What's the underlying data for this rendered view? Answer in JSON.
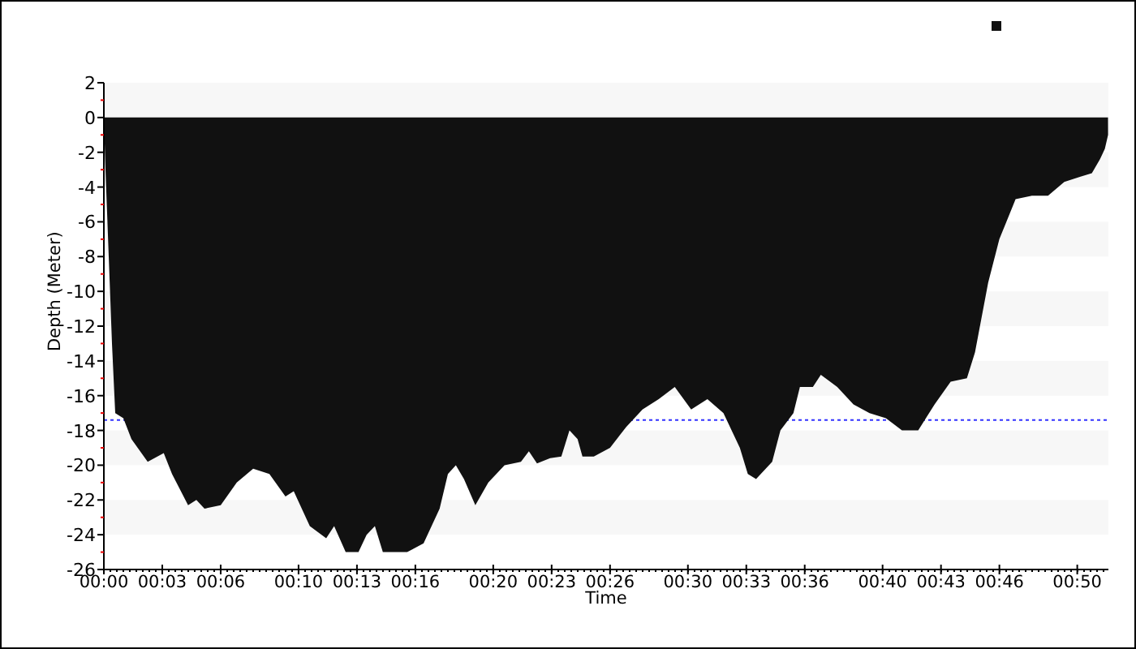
{
  "chart_data": {
    "type": "area",
    "xlabel": "Time",
    "ylabel": "Depth (Meter)",
    "xlim": [
      0,
      51.6
    ],
    "ylim": [
      -26,
      2
    ],
    "xticks": [
      {
        "value": 0,
        "label": "00:00"
      },
      {
        "value": 3,
        "label": "00:03"
      },
      {
        "value": 6,
        "label": "00:06"
      },
      {
        "value": 10,
        "label": "00:10"
      },
      {
        "value": 13,
        "label": "00:13"
      },
      {
        "value": 16,
        "label": "00:16"
      },
      {
        "value": 20,
        "label": "00:20"
      },
      {
        "value": 23,
        "label": "00:23"
      },
      {
        "value": 26,
        "label": "00:26"
      },
      {
        "value": 30,
        "label": "00:30"
      },
      {
        "value": 33,
        "label": "00:33"
      },
      {
        "value": 36,
        "label": "00:36"
      },
      {
        "value": 40,
        "label": "00:40"
      },
      {
        "value": 43,
        "label": "00:43"
      },
      {
        "value": 46,
        "label": "00:46"
      },
      {
        "value": 50,
        "label": "00:50"
      }
    ],
    "yticks": [
      2,
      0,
      -2,
      -4,
      -6,
      -8,
      -10,
      -12,
      -14,
      -16,
      -18,
      -20,
      -22,
      -24,
      -26
    ],
    "x": [
      0,
      0.08,
      0.25,
      0.42,
      0.58,
      1,
      1.42,
      2.25,
      3.08,
      3.5,
      4.33,
      4.75,
      5.17,
      6,
      6.83,
      7.67,
      8.5,
      9.33,
      9.75,
      10.58,
      11.42,
      11.83,
      12.42,
      13.08,
      13.5,
      13.92,
      14.33,
      15.58,
      16.42,
      17.25,
      17.67,
      18.08,
      18.5,
      19.08,
      19.75,
      20.58,
      21.42,
      21.83,
      22.25,
      22.92,
      23.5,
      23.92,
      24.33,
      24.58,
      25.17,
      26,
      26.83,
      27.67,
      28.5,
      29.33,
      30.17,
      31,
      31.83,
      32.67,
      33.08,
      33.5,
      34.33,
      34.75,
      35.42,
      35.75,
      36.42,
      36.83,
      37.67,
      38.5,
      39.33,
      40.17,
      41,
      41.83,
      42.67,
      43.5,
      44.33,
      44.75,
      45.42,
      46,
      46.83,
      47.67,
      48.5,
      49.33,
      50.17,
      50.75,
      51.17,
      51.42,
      51.58
    ],
    "series": [
      {
        "color": "#111111",
        "values": [
          0,
          -3,
          -8,
          -13,
          -17,
          -17.3,
          -18.5,
          -19.8,
          -19.3,
          -20.5,
          -22.3,
          -22,
          -22.5,
          -22.3,
          -21,
          -20.2,
          -20.5,
          -21.8,
          -21.5,
          -23.5,
          -24.2,
          -23.5,
          -25,
          -25,
          -24,
          -23.5,
          -25,
          -25,
          -24.5,
          -22.5,
          -20.5,
          -20,
          -20.8,
          -22.3,
          -21,
          -20,
          -19.8,
          -19.2,
          -19.9,
          -19.6,
          -19.5,
          -18,
          -18.5,
          -19.5,
          -19.5,
          -19,
          -17.8,
          -16.8,
          -16.2,
          -15.5,
          -16.8,
          -16.2,
          -17,
          -19,
          -20.5,
          -20.8,
          -19.8,
          -18,
          -17,
          -15.5,
          -15.5,
          -14.8,
          -15.5,
          -16.5,
          -17,
          -17.3,
          -18,
          -18,
          -16.5,
          -15.2,
          -15,
          -13.5,
          -9.5,
          -7,
          -4.7,
          -4.5,
          -4.5,
          -3.7,
          -3.4,
          -3.2,
          -2.4,
          -1.8,
          -1
        ]
      }
    ],
    "ref_lines": [
      {
        "axis": "y",
        "value": -17.4,
        "color": "#3333ff"
      }
    ]
  }
}
